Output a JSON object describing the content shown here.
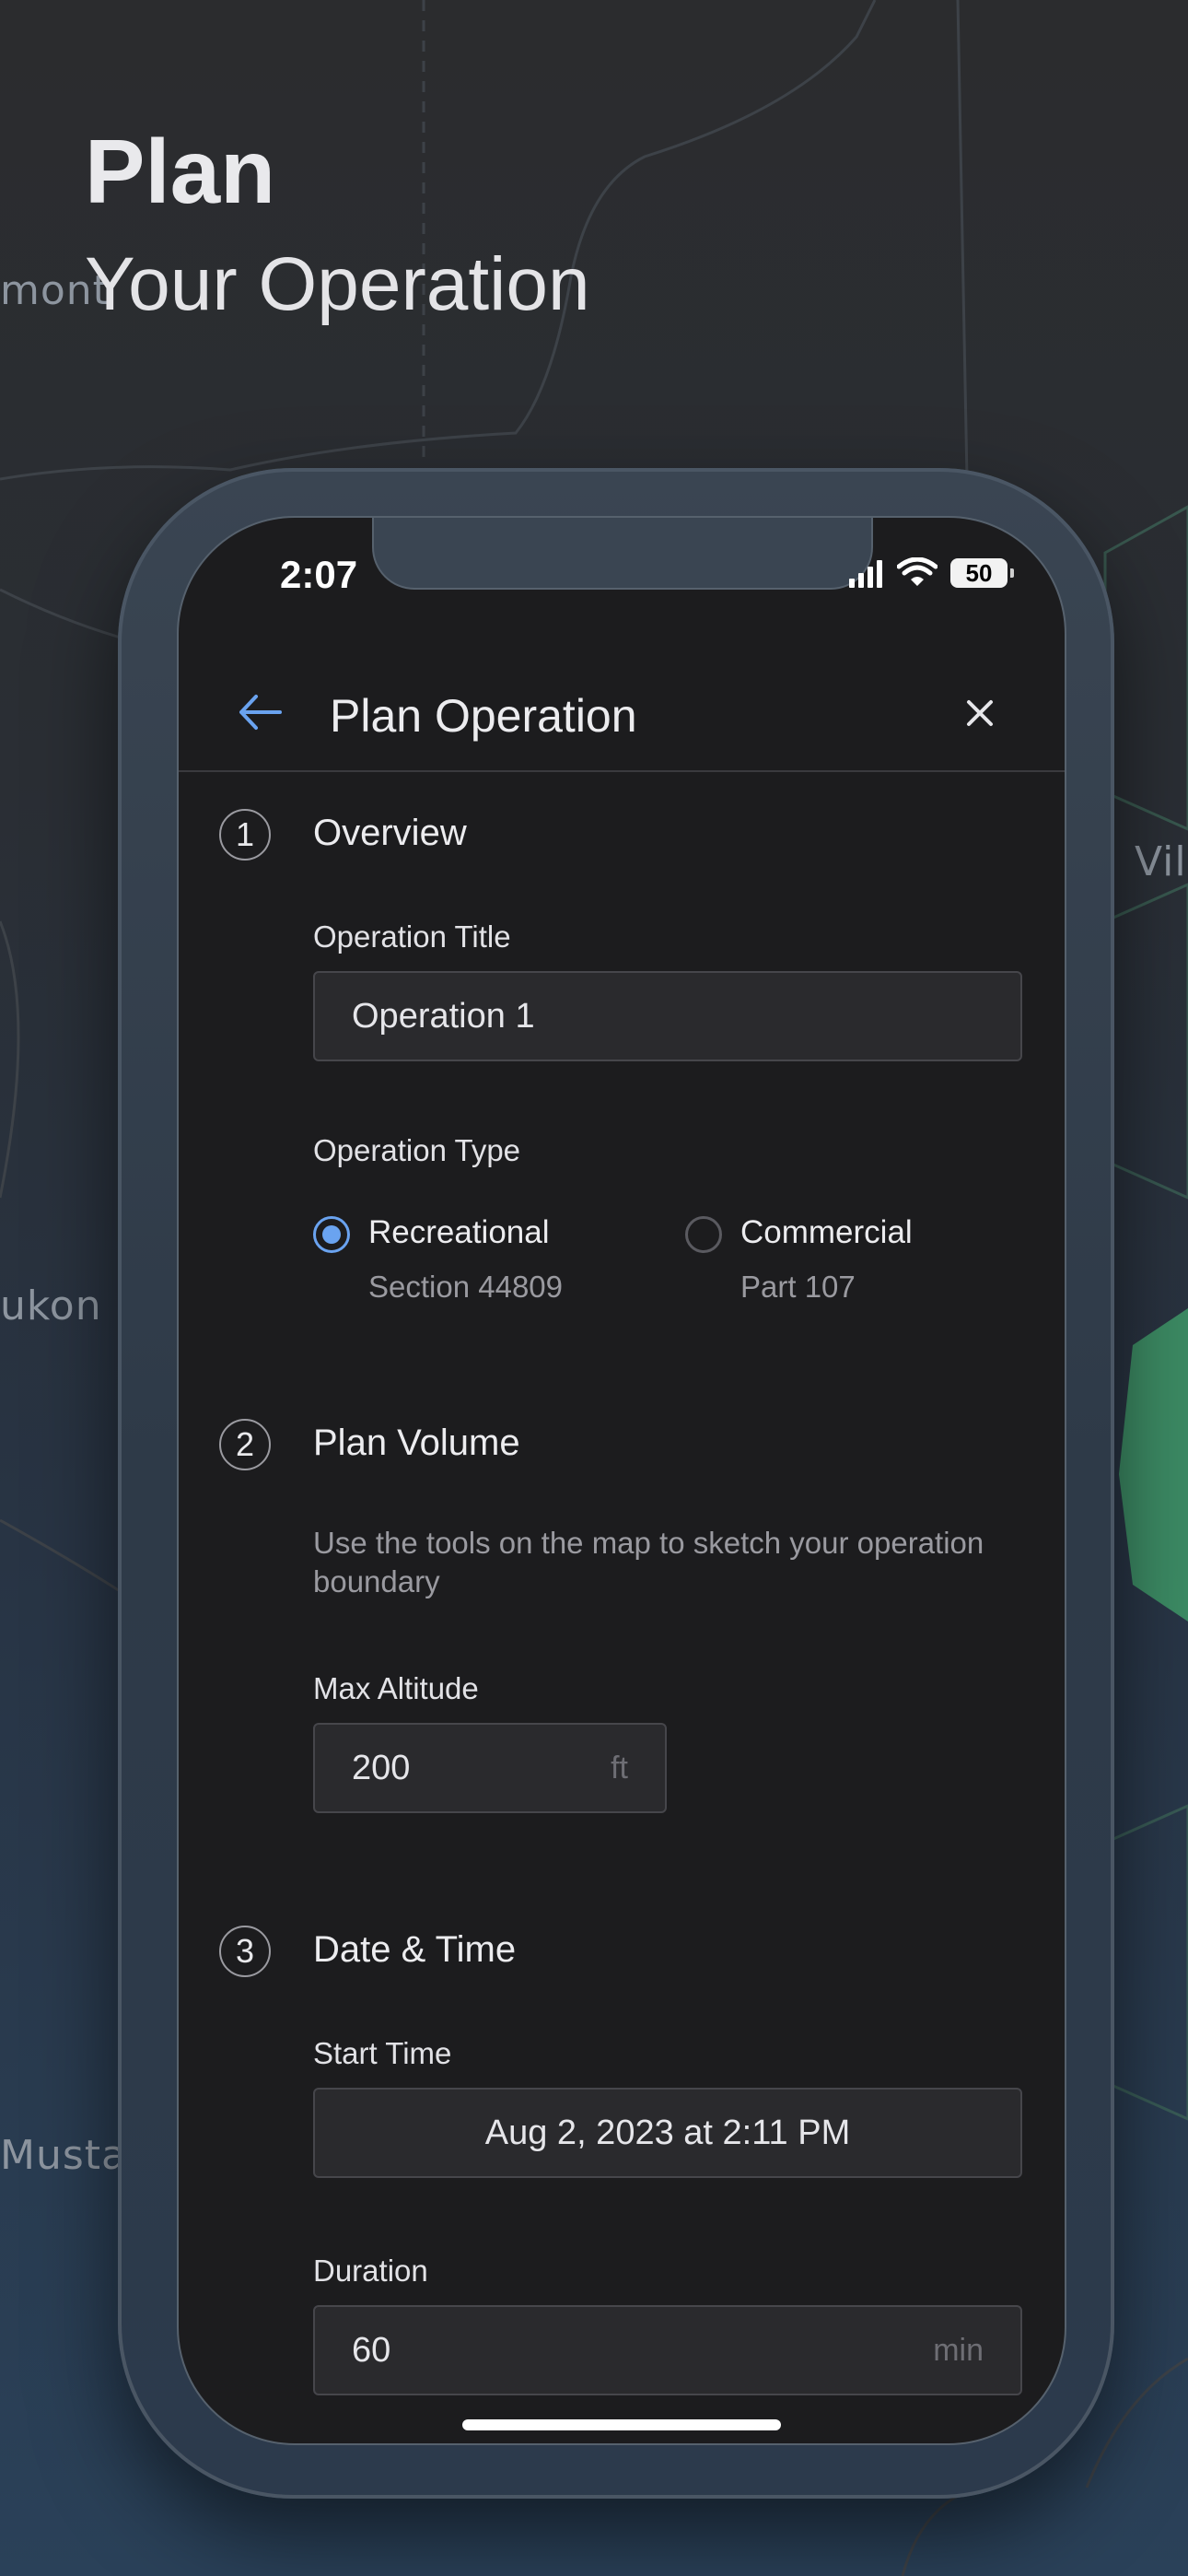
{
  "marketing": {
    "headline": "Plan",
    "subheadline": "Your Operation"
  },
  "map": {
    "labels": [
      "mont",
      "Vil",
      "ukon",
      "Musta"
    ]
  },
  "status_bar": {
    "time": "2:07",
    "battery": "50"
  },
  "nav": {
    "title": "Plan Operation"
  },
  "steps": [
    {
      "number": "1",
      "title": "Overview",
      "operation_title_label": "Operation Title",
      "operation_title_value": "Operation 1",
      "operation_type_label": "Operation Type",
      "options": [
        {
          "label": "Recreational",
          "sub": "Section 44809",
          "selected": true
        },
        {
          "label": "Commercial",
          "sub": "Part 107",
          "selected": false
        }
      ]
    },
    {
      "number": "2",
      "title": "Plan Volume",
      "helper": "Use the tools on the map to sketch your operation boundary",
      "max_altitude_label": "Max Altitude",
      "max_altitude_value": "200",
      "max_altitude_unit": "ft"
    },
    {
      "number": "3",
      "title": "Date & Time",
      "start_time_label": "Start Time",
      "start_time_value": "Aug 2, 2023 at 2:11 PM",
      "duration_label": "Duration",
      "duration_value": "60",
      "duration_unit": "min"
    }
  ],
  "colors": {
    "accent": "#6aa3f0",
    "screen_bg": "#1c1c1e",
    "map_green": "#3f9a6a"
  }
}
